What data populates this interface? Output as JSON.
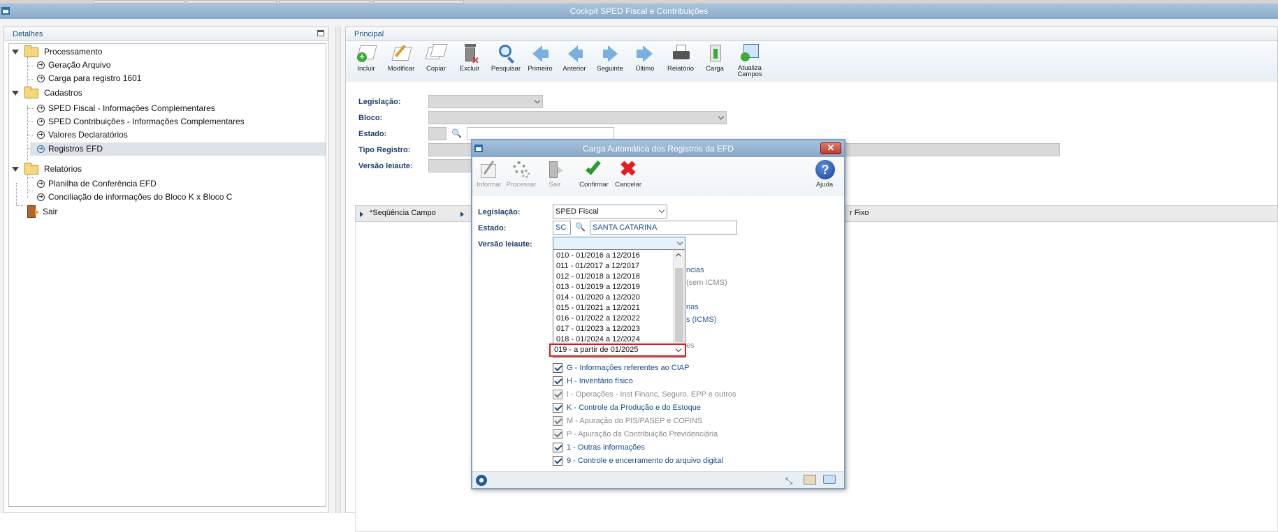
{
  "window": {
    "title": "Cockpit SPED Fiscal e Contribuições"
  },
  "left_panel": {
    "header": "Detalhes",
    "tree": [
      {
        "label": "Processamento",
        "kind": "folder"
      },
      {
        "label": "Geração Arquivo",
        "kind": "item"
      },
      {
        "label": "Carga para registro 1601",
        "kind": "item"
      },
      {
        "label": "Cadastros",
        "kind": "folder"
      },
      {
        "label": "SPED Fiscal - Informações Complementares",
        "kind": "item"
      },
      {
        "label": "SPED Contribuições - Informações Complementares",
        "kind": "item"
      },
      {
        "label": "Valores Declaratórios",
        "kind": "item"
      },
      {
        "label": "Registros EFD",
        "kind": "item",
        "selected": true
      },
      {
        "label": "Relatórios",
        "kind": "folder"
      },
      {
        "label": "Planilha de Conferência EFD",
        "kind": "item"
      },
      {
        "label": "Conciliação de informações do Bloco K x Bloco C",
        "kind": "item"
      },
      {
        "label": "Sair",
        "kind": "exit"
      }
    ]
  },
  "right_panel": {
    "header": "Principal",
    "toolbar": [
      "Incluir",
      "Modificar",
      "Copiar",
      "Excluir",
      "Pesquisar",
      "Primeiro",
      "Anterior",
      "Seguinte",
      "Último",
      "Relatório",
      "Carga",
      "Atualiza",
      "Campos"
    ],
    "fields": {
      "legislacao": "Legislação:",
      "bloco": "Bloco:",
      "estado": "Estado:",
      "tipo_registro": "Tipo Registro:",
      "versao_leiaute": "Versão leiaute:"
    },
    "grid": {
      "col1": "*Seqüência Campo",
      "col_right": "r Fixo"
    }
  },
  "dialog": {
    "title": "Carga Automática dos Registros da EFD",
    "toolbar": {
      "informar": "Informar",
      "processar": "Processar",
      "sair": "Sair",
      "confirmar": "Confirmar",
      "cancelar": "Cancelar",
      "ajuda": "Ajuda"
    },
    "legislacao_label": "Legislação:",
    "legislacao_value": "SPED Fiscal",
    "estado_label": "Estado:",
    "estado_code": "SC",
    "estado_name": "SANTA CATARINA",
    "versao_label": "Versão leiaute:",
    "versao_options": [
      "010 - 01/2016 a 12/2016",
      "011 - 01/2017 a 12/2017",
      "012 - 01/2018 a 12/2018",
      "013 - 01/2019 a 12/2019",
      "014 - 01/2020 a 12/2020",
      "015 - 01/2021 a 12/2021",
      "016 - 01/2022 a 12/2022",
      "017 - 01/2023 a 12/2023",
      "018 - 01/2024 a 12/2024"
    ],
    "versao_selected": "019 - a partir de 01/2025",
    "behind_texts": [
      "ncias",
      "(sem ICMS)",
      "rias",
      "s (ICMS)",
      "es"
    ],
    "blocks": [
      {
        "label": "G - Informações referentes ao CIAP",
        "enabled": true
      },
      {
        "label": "H - Inventário físico",
        "enabled": true
      },
      {
        "label": "I - Operações - Inst Financ, Seguro, EPP e outros",
        "enabled": false
      },
      {
        "label": "K - Controle da Produção e do Estoque",
        "enabled": true
      },
      {
        "label": "M - Apuração do PIS/PASEP e COFINS",
        "enabled": false
      },
      {
        "label": "P - Apuração da Contribuição Previdenciária",
        "enabled": false
      },
      {
        "label": "1 - Outras informações",
        "enabled": true
      },
      {
        "label": "9 - Controle e encerramento do arquivo digital",
        "enabled": true
      }
    ]
  },
  "colors": {
    "title_bar": "#8aa9c8",
    "highlight": "#e3141a",
    "label": "#1f3f6a"
  }
}
